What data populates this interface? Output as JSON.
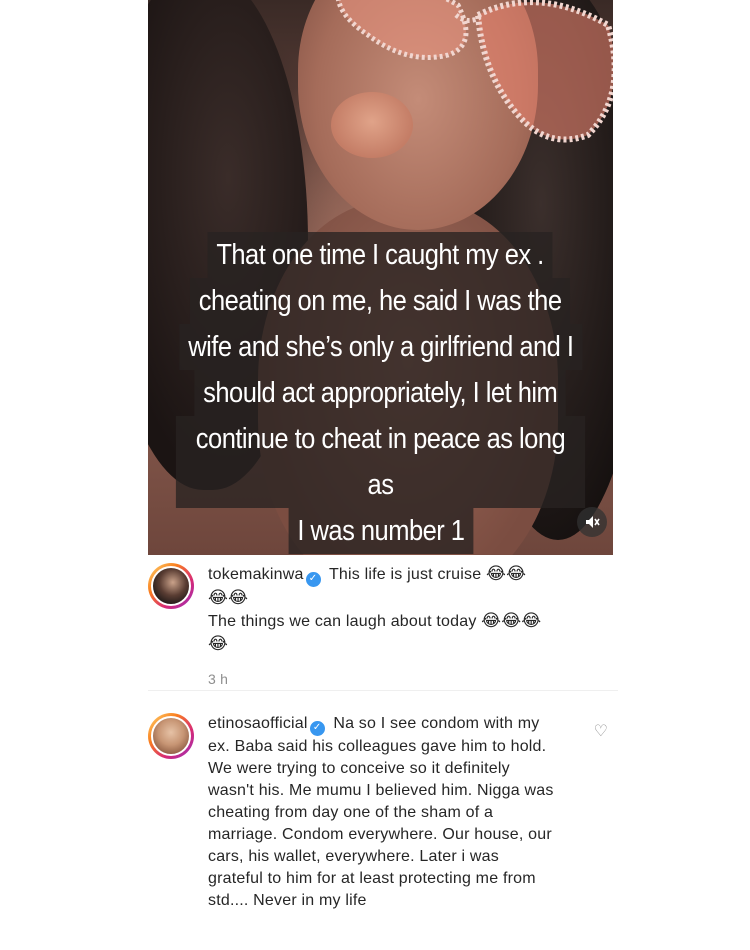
{
  "story": {
    "caption_lines": [
      "That one time I caught my ex .",
      "cheating  on me, he said I was the",
      "wife and she’s only a girlfriend and I",
      "should act appropriately,  I let him",
      "continue to cheat in peace as long as",
      "I was number 1"
    ],
    "caption_emoji": "😂😂😂",
    "mute_icon": "speaker-muted-icon"
  },
  "comments": [
    {
      "username": "tokemakinwa",
      "verified_icon": "verified-badge-icon",
      "text_1": "This life is just cruise",
      "emoji_1": "😂😂",
      "emoji_2": "😂😂",
      "text_2": "The things we can laugh about today",
      "emoji_3": "😂😂😂",
      "emoji_4": "😂",
      "time": "3 h"
    },
    {
      "username": "etinosaofficial",
      "verified_icon": "verified-badge-icon",
      "text": "Na so I see condom with my ex. Baba said his colleagues gave him to hold. We were trying to conceive so it definitely wasn't his. Me mumu I believed him. Nigga was cheating from day one of the sham of a marriage. Condom everywhere. Our house, our cars, his wallet, everywhere. Later i was grateful to him for at least protecting me from std.... Never in my life",
      "like_icon": "heart-icon"
    }
  ],
  "colors": {
    "verified": "#3897f0",
    "timestamp": "#8e8e8e",
    "caption_bg": "#282221"
  }
}
